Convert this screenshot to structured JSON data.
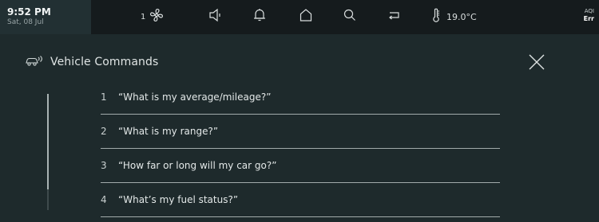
{
  "status_bar": {
    "time": "9:52 PM",
    "date": "Sat, 08 Jul",
    "fan_speed": "1",
    "temperature": "19.0°C",
    "aqi_label": "AQI",
    "aqi_value": "Err",
    "icons": [
      "fan-icon",
      "volume-icon",
      "bell-icon",
      "home-icon",
      "search-icon",
      "back-icon",
      "thermometer-icon"
    ]
  },
  "header": {
    "title": "Vehicle Commands",
    "title_icon": "vehicle-command-icon",
    "close_icon": "close-icon"
  },
  "scroll": {
    "position_fraction": 0.0,
    "visible_fraction": 0.82
  },
  "commands": [
    {
      "number": "1",
      "text": "“What is my average/mileage?”"
    },
    {
      "number": "2",
      "text": "“What is my range?”"
    },
    {
      "number": "3",
      "text": "“How far or long will my car go?”"
    },
    {
      "number": "4",
      "text": "“What’s my fuel status?”"
    }
  ],
  "colors": {
    "background": "#1e2a2c",
    "status_bar": "#151b1d",
    "clock_box": "#223033",
    "divider": "#a2abab",
    "text": "#e3e8e8"
  }
}
